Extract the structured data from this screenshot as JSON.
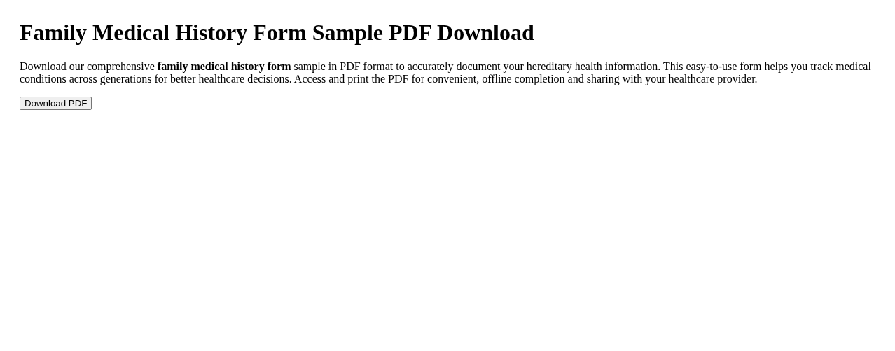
{
  "heading": "Family Medical History Form Sample PDF Download",
  "description": "Download our comprehensive **family medical history form** sample in PDF format to accurately document your hereditary health information. This easy-to-use form helps you track medical conditions across generations for better healthcare decisions. Access and print the PDF for convenient, offline completion and sharing with your healthcare provider.",
  "button": "Download PDF"
}
